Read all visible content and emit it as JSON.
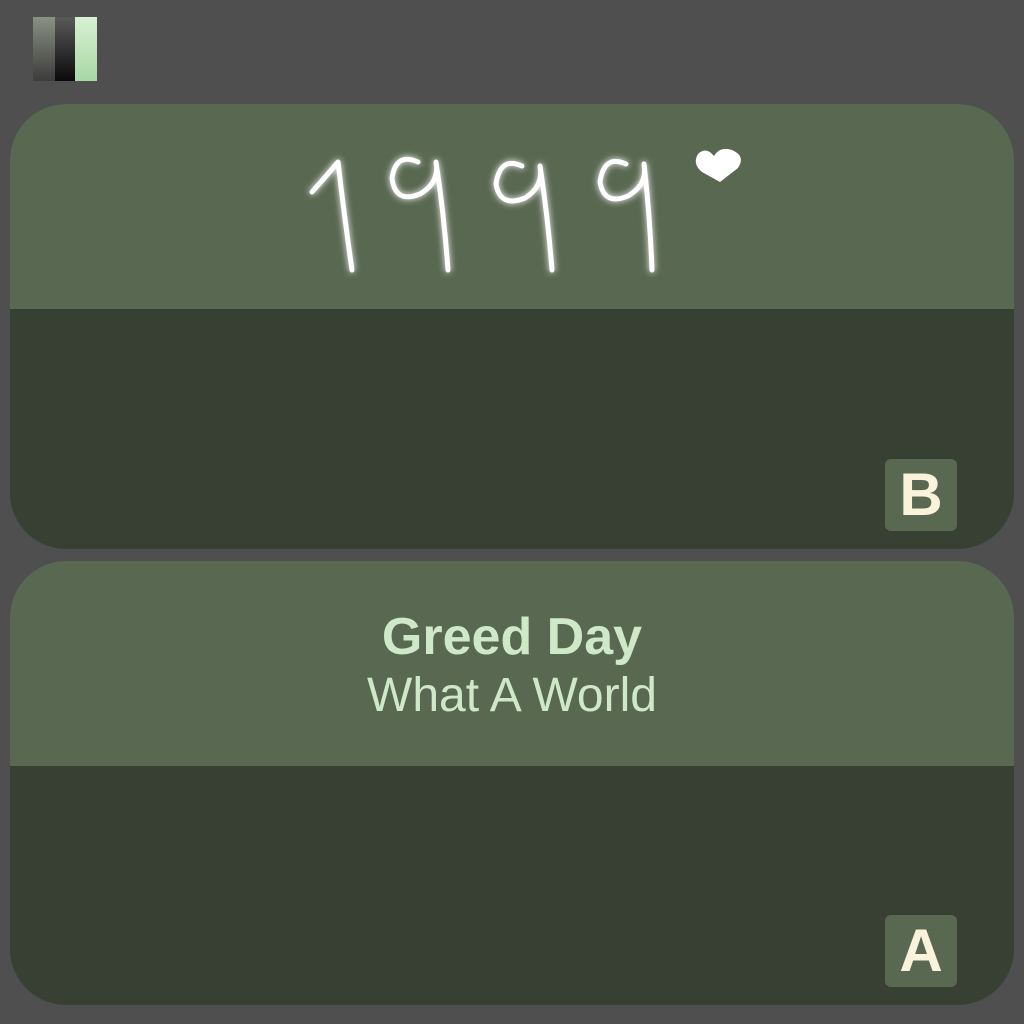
{
  "header": {
    "pause_icon": "pause-icon"
  },
  "options": [
    {
      "id": "B",
      "image_text": "1999",
      "image_icon": "heart-icon",
      "button_label": "B"
    },
    {
      "id": "A",
      "title": "Greed Day",
      "subtitle": "What A World",
      "button_label": "A"
    }
  ],
  "colors": {
    "background": "#4f4f4f",
    "card_top": "#596851",
    "card_bottom": "#384033",
    "text_accent": "#cfe8c7",
    "button_text": "#fbf2dc"
  }
}
